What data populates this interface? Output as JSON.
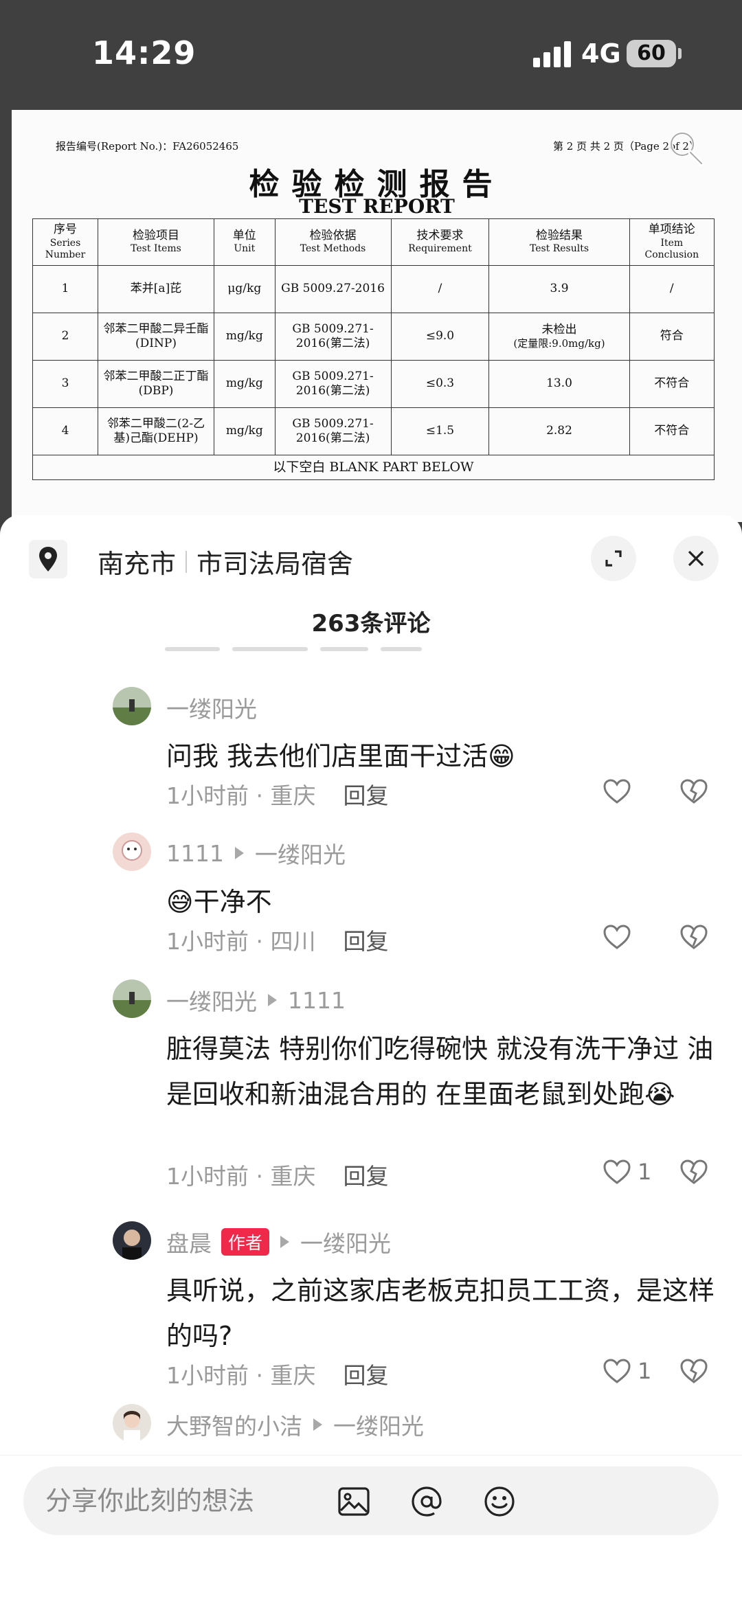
{
  "status_bar": {
    "time": "14:29",
    "network": "4G",
    "battery": "60"
  },
  "report": {
    "report_no": "报告编号(Report No.)：FA26052465",
    "page": "第 2 页  共 2 页（Page 2of 2）",
    "title": "检验检测报告",
    "subtitle": "TEST REPORT",
    "headers": [
      {
        "cn": "序号",
        "en": "Series Number"
      },
      {
        "cn": "检验项目",
        "en": "Test Items"
      },
      {
        "cn": "单位",
        "en": "Unit"
      },
      {
        "cn": "检验依据",
        "en": "Test Methods"
      },
      {
        "cn": "技术要求",
        "en": "Requirement"
      },
      {
        "cn": "检验结果",
        "en": "Test Results"
      },
      {
        "cn": "单项结论",
        "en": "Item Conclusion"
      }
    ],
    "rows": [
      {
        "no": "1",
        "item": "苯并[a]芘",
        "unit": "μg/kg",
        "method": "GB 5009.27-2016",
        "req": "/",
        "result": "3.9",
        "result_note": "",
        "conclusion": "/"
      },
      {
        "no": "2",
        "item": "邻苯二甲酸二异壬酯(DINP)",
        "unit": "mg/kg",
        "method": "GB 5009.271-2016(第二法)",
        "req": "≤9.0",
        "result": "未检出",
        "result_note": "(定量限:9.0mg/kg)",
        "conclusion": "符合"
      },
      {
        "no": "3",
        "item": "邻苯二甲酸二正丁酯(DBP)",
        "unit": "mg/kg",
        "method": "GB 5009.271-2016(第二法)",
        "req": "≤0.3",
        "result": "13.0",
        "result_note": "",
        "conclusion": "不符合"
      },
      {
        "no": "4",
        "item": "邻苯二甲酸二(2-乙基)己酯(DEHP)",
        "unit": "mg/kg",
        "method": "GB 5009.271-2016(第二法)",
        "req": "≤1.5",
        "result": "2.82",
        "result_note": "",
        "conclusion": "不符合"
      }
    ],
    "blank_note": "以下空白 BLANK PART BELOW"
  },
  "location": {
    "city": "南充市",
    "place": "市司法局宿舍"
  },
  "comments_title": "263条评论",
  "comments": [
    {
      "user": "一缕阳光",
      "reply_to": "",
      "is_author": false,
      "text": "问我 我去他们店里面干过活😁",
      "time": "1小时前 · 重庆",
      "reply_label": "回复",
      "likes": ""
    },
    {
      "user": "1111",
      "reply_to": "一缕阳光",
      "is_author": false,
      "text": "😅干净不",
      "time": "1小时前 · 四川",
      "reply_label": "回复",
      "likes": ""
    },
    {
      "user": "一缕阳光",
      "reply_to": "1111",
      "is_author": false,
      "text": "脏得莫法 特别你们吃得碗快 就没有洗干净过 油是回收和新油混合用的 在里面老鼠到处跑😭",
      "time": "1小时前 · 重庆",
      "reply_label": "回复",
      "likes": "1"
    },
    {
      "user": "盘晨",
      "reply_to": "一缕阳光",
      "is_author": true,
      "author_label": "作者",
      "text": "具听说，之前这家店老板克扣员工工资，是这样的吗?",
      "time": "1小时前 · 重庆",
      "reply_label": "回复",
      "likes": "1"
    },
    {
      "user": "大野智的小洁",
      "reply_to": "一缕阳光",
      "is_author": false,
      "text": "",
      "time": "",
      "reply_label": "",
      "likes": ""
    }
  ],
  "input": {
    "placeholder": "分享你此刻的想法"
  },
  "icons": [
    "location-pin-icon",
    "expand-icon",
    "close-icon",
    "heart-icon",
    "broken-heart-icon",
    "image-icon",
    "at-icon",
    "emoji-icon",
    "search-icon"
  ],
  "colors": {
    "author_tag": "#f0294a",
    "status_bar_bg": "#404040"
  }
}
